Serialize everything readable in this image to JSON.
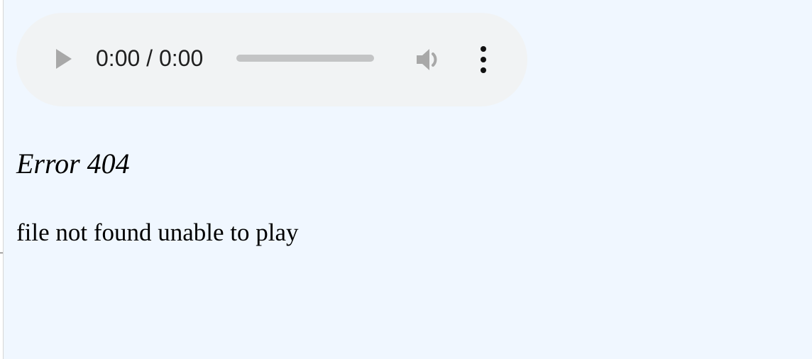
{
  "audio_player": {
    "time_display": "0:00 / 0:00",
    "progress": 0,
    "icons": {
      "play": "play-icon",
      "volume": "volume-icon",
      "more": "more-vertical-icon"
    },
    "colors": {
      "background": "#f1f3f4",
      "icon": "#a8a8a8",
      "track": "#c3c4c5",
      "text": "#1f1f1f"
    }
  },
  "error": {
    "title": "Error 404",
    "message": "file not found unable to play"
  },
  "page": {
    "background": "#f0f7ff"
  }
}
